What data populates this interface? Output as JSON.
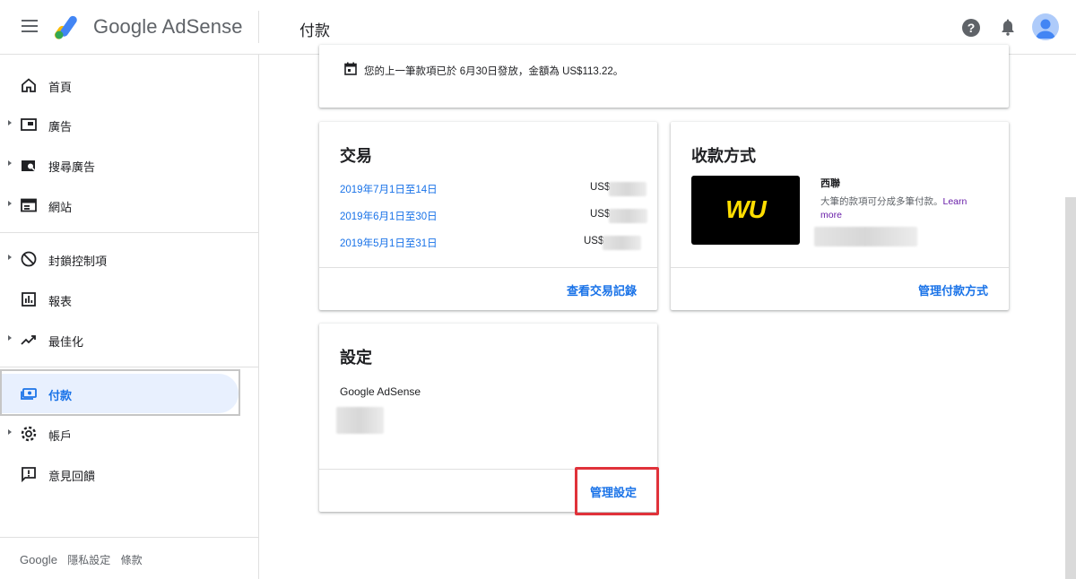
{
  "header": {
    "app_name": "Google AdSense",
    "page_title": "付款",
    "help_glyph": "?"
  },
  "sidebar": {
    "items": [
      {
        "label": "首頁",
        "icon": "home-icon"
      },
      {
        "label": "廣告",
        "icon": "ads-icon"
      },
      {
        "label": "搜尋廣告",
        "icon": "search-ads-icon"
      },
      {
        "label": "網站",
        "icon": "sites-icon"
      },
      {
        "label": "封鎖控制項",
        "icon": "block-icon"
      },
      {
        "label": "報表",
        "icon": "reports-icon"
      },
      {
        "label": "最佳化",
        "icon": "optimization-icon"
      },
      {
        "label": "付款",
        "icon": "payments-icon"
      },
      {
        "label": "帳戶",
        "icon": "account-gear-icon"
      },
      {
        "label": "意見回饋",
        "icon": "feedback-icon"
      }
    ],
    "footer": {
      "google": "Google",
      "privacy": "隱私設定",
      "terms": "條款"
    }
  },
  "notice": {
    "text": "您的上一筆款項已於 6月30日發放，金額為 US$113.22。"
  },
  "transactions": {
    "title": "交易",
    "rows": [
      {
        "period": "2019年7月1日至14日",
        "amount_prefix": "US$"
      },
      {
        "period": "2019年6月1日至30日",
        "amount_prefix": "US$"
      },
      {
        "period": "2019年5月1日至31日",
        "amount_prefix": "US$"
      }
    ],
    "action": "查看交易記錄"
  },
  "payment_method": {
    "title": "收款方式",
    "logo_text": "WU",
    "name": "西聯",
    "description": "大筆的款項可分成多筆付款。",
    "learn_more": "Learn more",
    "action": "管理付款方式"
  },
  "settings": {
    "title": "設定",
    "subtitle": "Google AdSense",
    "action": "管理設定"
  },
  "colors": {
    "accent": "#1a73e8",
    "active_bg": "#e8f0fe",
    "highlight_red": "#e0323a",
    "wu_yellow": "#ffdd00"
  }
}
